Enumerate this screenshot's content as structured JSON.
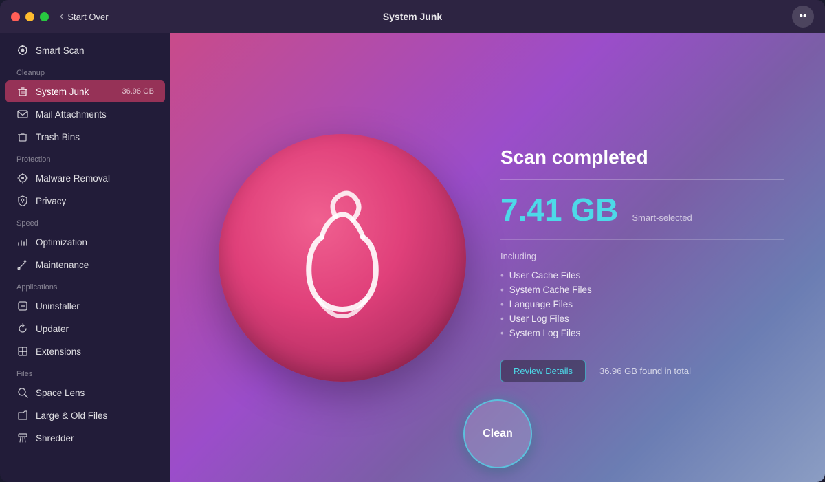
{
  "window": {
    "title": "System Junk",
    "nav_back": "Start Over"
  },
  "sidebar": {
    "smart_scan": "Smart Scan",
    "sections": [
      {
        "label": "Cleanup",
        "items": [
          {
            "id": "system-junk",
            "label": "System Junk",
            "badge": "36.96 GB",
            "active": true,
            "icon": "🗑"
          },
          {
            "id": "mail-attachments",
            "label": "Mail Attachments",
            "badge": "",
            "active": false,
            "icon": "✉"
          },
          {
            "id": "trash-bins",
            "label": "Trash Bins",
            "badge": "",
            "active": false,
            "icon": "🗑"
          }
        ]
      },
      {
        "label": "Protection",
        "items": [
          {
            "id": "malware-removal",
            "label": "Malware Removal",
            "badge": "",
            "active": false,
            "icon": "☣"
          },
          {
            "id": "privacy",
            "label": "Privacy",
            "badge": "",
            "active": false,
            "icon": "🔒"
          }
        ]
      },
      {
        "label": "Speed",
        "items": [
          {
            "id": "optimization",
            "label": "Optimization",
            "badge": "",
            "active": false,
            "icon": "📊"
          },
          {
            "id": "maintenance",
            "label": "Maintenance",
            "badge": "",
            "active": false,
            "icon": "🔧"
          }
        ]
      },
      {
        "label": "Applications",
        "items": [
          {
            "id": "uninstaller",
            "label": "Uninstaller",
            "badge": "",
            "active": false,
            "icon": "📦"
          },
          {
            "id": "updater",
            "label": "Updater",
            "badge": "",
            "active": false,
            "icon": "🔄"
          },
          {
            "id": "extensions",
            "label": "Extensions",
            "badge": "",
            "active": false,
            "icon": "🧩"
          }
        ]
      },
      {
        "label": "Files",
        "items": [
          {
            "id": "space-lens",
            "label": "Space Lens",
            "badge": "",
            "active": false,
            "icon": "🔍"
          },
          {
            "id": "large-old-files",
            "label": "Large & Old Files",
            "badge": "",
            "active": false,
            "icon": "📁"
          },
          {
            "id": "shredder",
            "label": "Shredder",
            "badge": "",
            "active": false,
            "icon": "🗂"
          }
        ]
      }
    ]
  },
  "main": {
    "scan_completed": "Scan completed",
    "size": "7.41 GB",
    "smart_selected": "Smart-selected",
    "including": "Including",
    "files": [
      "User Cache Files",
      "System Cache Files",
      "Language Files",
      "User Log Files",
      "System Log Files"
    ],
    "review_btn": "Review Details",
    "found_total": "36.96 GB found in total",
    "clean_btn": "Clean"
  }
}
